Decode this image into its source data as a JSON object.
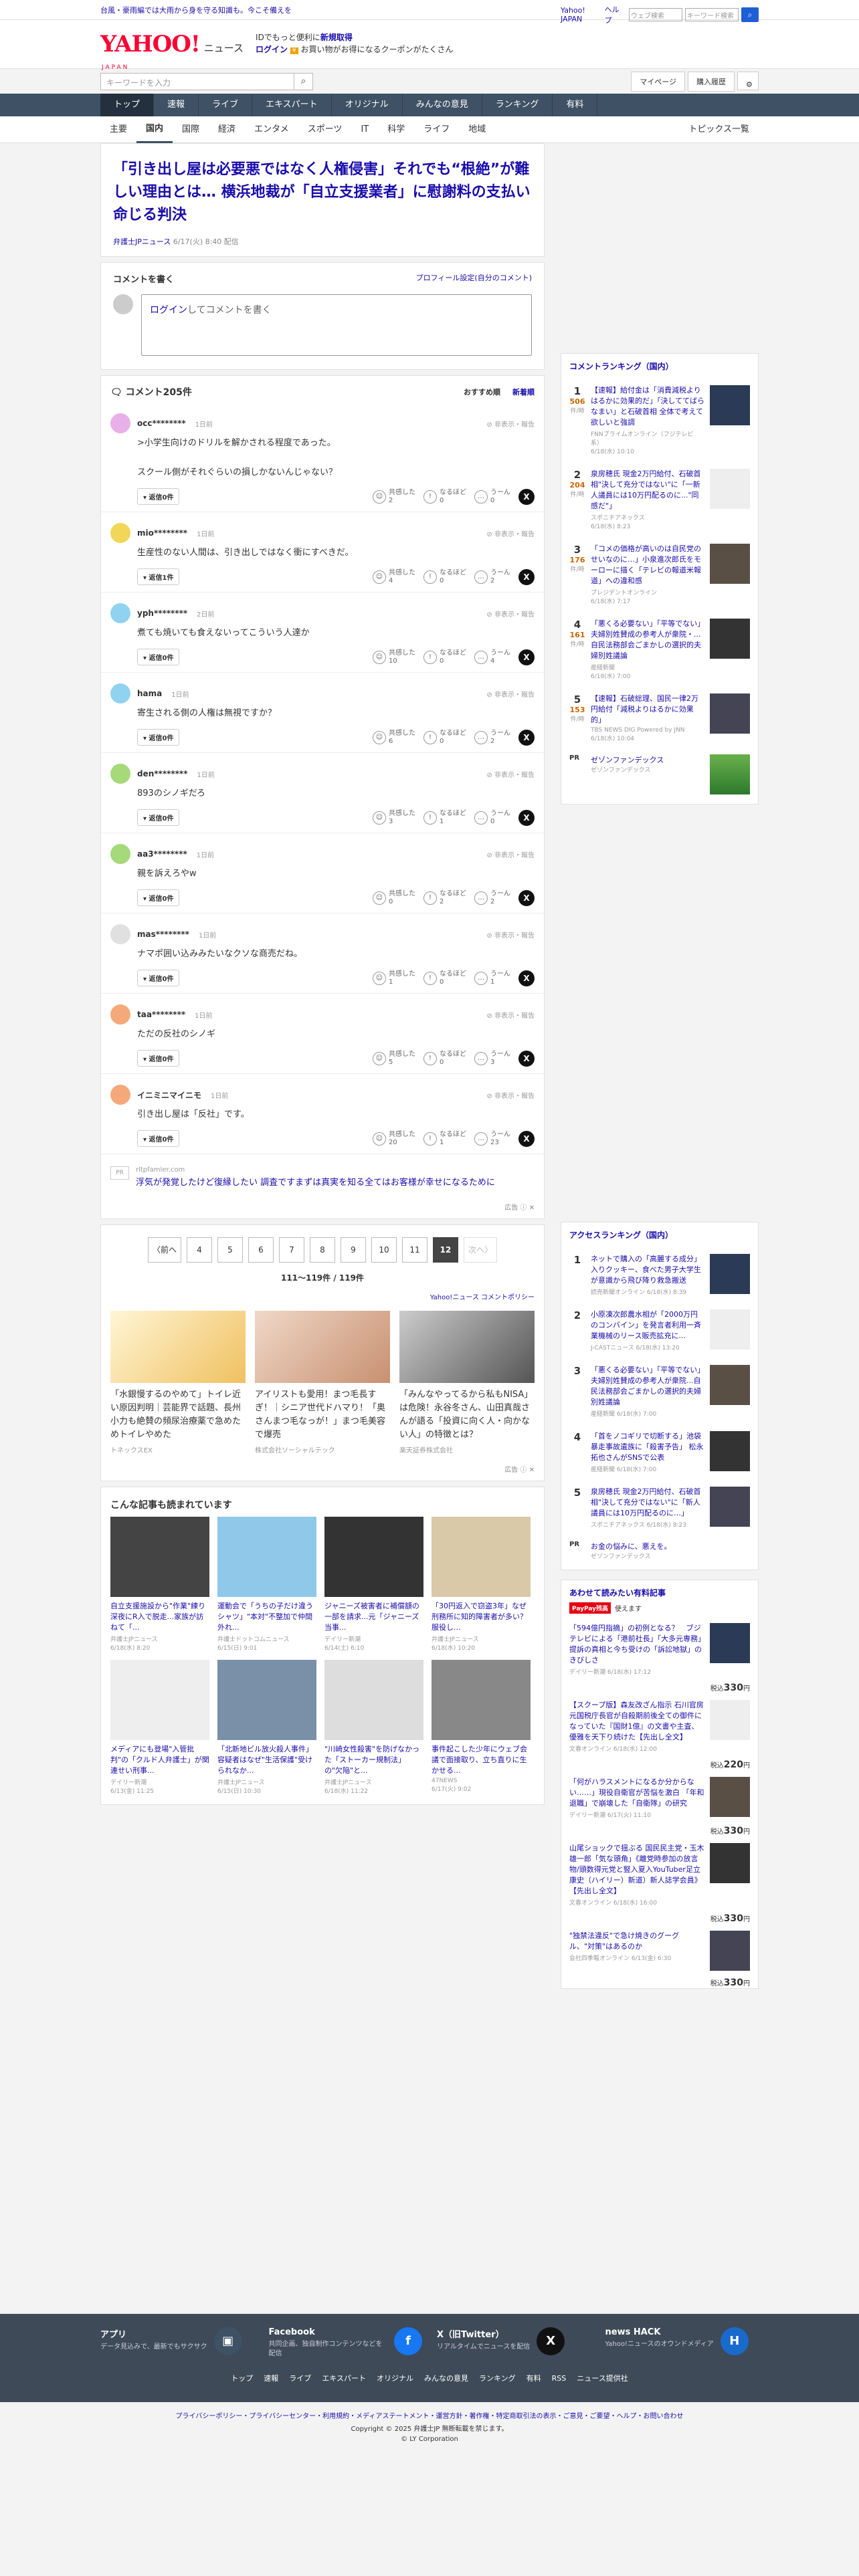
{
  "topbar": {
    "promo": "台風・豪雨編では大雨から身を守る知識も。今こそ備えを",
    "links": [
      "Yahoo! JAPAN",
      "ヘルプ"
    ],
    "web_search_placeholder": "ウェブ検索",
    "keyword_select": "キーワード検索",
    "search_btn": "検索"
  },
  "logo": {
    "main": "YAHOO!",
    "sub": "ニュース",
    "jp": "JAPAN"
  },
  "app_ad": {
    "line1": "IDでもっと便利に",
    "line1_link": "新規取得",
    "login": "ログイン",
    "line2": "お買い物がお得になるクーポンがたくさん"
  },
  "search": {
    "placeholder": "キーワードを入力",
    "mypage": "マイページ",
    "history": "購入履歴"
  },
  "nav1": [
    "トップ",
    "速報",
    "ライブ",
    "エキスパート",
    "オリジナル",
    "みんなの意見",
    "ランキング",
    "有料"
  ],
  "nav2": [
    "主要",
    "国内",
    "国際",
    "経済",
    "エンタメ",
    "スポーツ",
    "IT",
    "科学",
    "ライフ",
    "地域"
  ],
  "topics_link": "トピックス一覧",
  "article": {
    "title": "「引き出し屋は必要悪ではなく人権侵害」それでも“根絶”が難しい理由とは… 横浜地裁が「自立支援業者」に慰謝料の支払い命じる判決",
    "source": "弁護士JPニュース",
    "date": "6/17(火) 8:40 配信"
  },
  "comment_box": {
    "label": "コメントを書く",
    "profile": "プロフィール設定(自分のコメント)",
    "login": "ログイン",
    "prompt": "してコメントを書く"
  },
  "comments_header": {
    "count": "コメント205件",
    "sort_rec": "おすすめ順",
    "sort_new": "新着順"
  },
  "comment_labels": {
    "hide": "非表示・報告",
    "reply": "返信0件",
    "reply1": "返信1件",
    "agree": "共感した",
    "think": "なるほど",
    "hmm": "うーん"
  },
  "comments": [
    {
      "name": "occ********",
      "date": "1日前",
      "text": ">小学生向けのドリルを解かされる程度であった。\n\nスクール側がそれぐらいの損しかないんじゃない？",
      "reply": "返信0件",
      "agree": "2",
      "think": "0",
      "hmm": "0",
      "color": "#e8b0e8"
    },
    {
      "name": "mio********",
      "date": "1日前",
      "text": "生産性のない人間は、引き出しではなく衝にすべきだ。",
      "reply": "返信1件",
      "agree": "4",
      "think": "0",
      "hmm": "2",
      "color": "#f2d65a"
    },
    {
      "name": "yph********",
      "date": "2日前",
      "text": "煮ても焼いても食えないってこういう人達か",
      "reply": "返信0件",
      "agree": "10",
      "think": "0",
      "hmm": "4",
      "color": "#8fd3f0"
    },
    {
      "name": "hama",
      "date": "1日前",
      "text": "寄生される側の人権は無視ですか？",
      "reply": "返信0件",
      "agree": "6",
      "think": "0",
      "hmm": "2",
      "color": "#8fd3f0"
    },
    {
      "name": "den********",
      "date": "1日前",
      "text": "893のシノギだろ",
      "reply": "返信0件",
      "agree": "3",
      "think": "1",
      "hmm": "0",
      "color": "#a5d97a"
    },
    {
      "name": "aa3********",
      "date": "1日前",
      "text": "親を訴えろやw",
      "reply": "返信0件",
      "agree": "0",
      "think": "2",
      "hmm": "2",
      "color": "#a5d97a"
    },
    {
      "name": "mas********",
      "date": "1日前",
      "text": "ナマポ囲い込みみたいなクソな商売だね。",
      "reply": "返信0件",
      "agree": "1",
      "think": "0",
      "hmm": "1",
      "color": "#e0e0e0"
    },
    {
      "name": "taa********",
      "date": "1日前",
      "text": "ただの反社のシノギ",
      "reply": "返信0件",
      "agree": "5",
      "think": "0",
      "hmm": "3",
      "color": "#f5a97a"
    },
    {
      "name": "イニミニマイニモ",
      "date": "1日前",
      "text": "引き出し屋は「反社」です。",
      "reply": "返信0件",
      "agree": "20",
      "think": "1",
      "hmm": "23",
      "color": "#f5a97a"
    }
  ],
  "pr_item": {
    "tag": "PR",
    "src": "rltpfamler.com",
    "text": "浮気が発覚したけど復縁したい 調査ですまずは真実を知る全てはお客様が幸せになるために",
    "adlabel": "広告"
  },
  "pager": {
    "prev": "〈前へ",
    "pages": [
      "4",
      "5",
      "6",
      "7",
      "8",
      "9",
      "10",
      "11",
      "12"
    ],
    "current": "12",
    "next": "次へ〉",
    "count": "111〜119件 / 119件"
  },
  "policy": "Yahoo!ニュース コメントポリシー",
  "ads": [
    {
      "title": "「水銀慢するのやめて」トイレ近い原因判明｜芸能界で話題、長州小力も絶賛の頻尿治療薬で急めためトイレやめた",
      "src": "トネックスEX"
    },
    {
      "title": "アイリストも愛用！まつ毛長すぎ！｜シニア世代ドハマり！「奥さんまつ毛なっが！」まつ毛美容で爆売",
      "src": "株式会社ソーシャルテック"
    },
    {
      "title": "「みんなやってるから私もNISA」は危険！永谷冬さん、山田真哉さんが語る「投資に向く人・向かない人」の特徴とは？",
      "src": "楽天証券株式会社"
    }
  ],
  "ads_label": "広告",
  "reading_title": "こんな記事も読まれています",
  "reading": [
    {
      "title": "自立支援施設から\"作業\"練り深夜にR入で脱走...家族が訪ねて「...",
      "src": "弁護士JPニュース",
      "date": "6/18(水) 8:20"
    },
    {
      "title": "運動会で「うちの子だけ違うシャツ」\"本対\"不整加で仲間外れ...",
      "src": "弁護士ドットコムニュース",
      "date": "6/15(日) 9:01"
    },
    {
      "title": "ジャニーズ被害者に補償額の一部を請求...元「ジャニーズ当事...",
      "src": "デイリー新潮",
      "date": "6/14(土) 6:10"
    },
    {
      "title": "「30円返入で窃盗3年」なぜ刑務所に知的障害者が多い？ 服役し...",
      "src": "弁護士JPニュース",
      "date": "6/18(水) 10:20"
    },
    {
      "title": "メディアにも登場\"入管批判\"の「クルド人弁護士」が関連せい刑事...",
      "src": "デイリー新潮",
      "date": "6/13(金) 11:25"
    },
    {
      "title": "「北新地ビル放火殺人事件」容疑者はなぜ\"生活保護\"受けられなか...",
      "src": "弁護士JPニュース",
      "date": "6/15(日) 10:30"
    },
    {
      "title": "\"川崎女性殺害\"を防げなかった「ストーカー規制法」の\"欠陥\"と...",
      "src": "弁護士JPニュース",
      "date": "6/18(水) 11:22"
    },
    {
      "title": "事件起こした少年にウェブ会議で面接取り、立ち直りに生かせる...",
      "src": "47NEWS",
      "date": "6/17(火) 9:02"
    }
  ],
  "ranking": {
    "title": "コメントランキング（国内）",
    "items": [
      {
        "n": "1",
        "count": "506",
        "t": "【速報】給付金は「消費減税よりはるかに効果的だ」「決しててばらなまい」と石破首相 全体で考えて欲しいと強調",
        "s": "FNNプライムオンライン（フジテレビ系）",
        "d": "6/18(水) 10:10"
      },
      {
        "n": "2",
        "count": "204",
        "t": "泉房穂氏 現金2万円給付、石破首相\"決して充分ではない\"に「一新人議員には10万円配るのに...\"同感だ\"」",
        "s": "スポニチアネックス",
        "d": "6/18(水) 8:23"
      },
      {
        "n": "3",
        "count": "176",
        "t": "「コメの価格が高いのは自民党のせいなのに…」小泉進次郎氏をモーローに描く「テレビの報道米報道」への違和感",
        "s": "プレジデントオンライン",
        "d": "6/18(水) 7:17"
      },
      {
        "n": "4",
        "count": "161",
        "t": "「悪くる必要ない」「平等でない」夫婦別姓賛成の参考人が衆院・... 自民法務部会ごまかしの選択的夫婦別姓議論",
        "s": "産経新聞",
        "d": "6/18(水) 7:00"
      },
      {
        "n": "5",
        "count": "153",
        "t": "【速報】石破総理、国民一律2万円給付「減税よりはるかに効果的」",
        "s": "TBS NEWS DIG Powered by JNN",
        "d": "6/18(水) 10:04"
      }
    ],
    "count_label": "件/時"
  },
  "pr_side": {
    "tag": "PR",
    "t": "ゼゾンファンデックス",
    "s": "ゼゾンファンデックス"
  },
  "access": {
    "title": "アクセスランキング（国内）",
    "items": [
      {
        "n": "1",
        "t": "ネットで購入の「高麗する成分」入りクッキー、食べた男子大学生が意識から飛び降り救急搬送",
        "s": "読売新聞オンライン",
        "d": "6/18(水) 8:39"
      },
      {
        "n": "2",
        "t": "小原凍次郎農水相が「2000万円のコンバイン」を発言者利用一斉業機械のリース販売拡充に...",
        "s": "J-CASTニュース",
        "d": "6/18(水) 13:20"
      },
      {
        "n": "3",
        "t": "「悪くる必要ない」「平等でない」夫婦別姓賛成の参考人が衆院...自民法務部会ごまかしの選択的夫婦別姓議論",
        "s": "産経新聞",
        "d": "6/18(水) 7:00"
      },
      {
        "n": "4",
        "t": "「首をノコギリで切断する」池袋暴走事故遺族に「殺害予告」 松永拓也さんがSNSで公表",
        "s": "産経新聞",
        "d": "6/18(水) 7:00"
      },
      {
        "n": "5",
        "t": "泉房穂氏 現金2万円給付、石破首相\"決して充分ではない\"に「新人議員には10万円配るのに…」",
        "s": "スポニチアネックス",
        "d": "6/18(水) 8:23"
      }
    ]
  },
  "pr_side2": {
    "tag": "PR",
    "t": "お金の悩みに、悪えを。",
    "s": "ゼゾンファンデックス"
  },
  "shop": {
    "title": "あわせて読みたい有料記事",
    "paypay": "PayPay残高",
    "paypay_text": "使えます",
    "items": [
      {
        "t": "「594億円指摘」の初例となる？　ブジテレビによる「港前社長」「大多元専務」提訴の真相と今ち受けの「訴訟地獄」のきびしさ",
        "s": "デイリー新潮",
        "d": "6/18(水) 17:12",
        "price": "330"
      },
      {
        "t": "【スクープ版】森友改ざん指示 石川官房元国税庁長官が自殺期前後全ての御件になっていた『国財1億』の文書や主査、優雅を天下り続けた【先出し全文】",
        "s": "文春オンライン",
        "d": "6/18(水) 12:00",
        "price": "220"
      },
      {
        "t": "「何がハラスメントになるか分からない……」現役自衛官が苦悩を激白 「年和退職」で崩壊した「自衛隊」の研究",
        "s": "デイリー新潮",
        "d": "6/17(火) 11:10",
        "price": "330"
      },
      {
        "t": "山尾ショックで揺ぶる 国民民主党・玉木雄一郎「気な頭角」《離党時参加の放言物/頭数得元党と竪入夏入YouTuber足立康史（ハイリー）新道）新人誌学会員》【先出し全文】",
        "s": "文春オンライン",
        "d": "6/18(水) 16:00",
        "price": "330"
      },
      {
        "t": "\"独禁法違反\"で急け焼きのグーグル、\"対策\"はあるのか",
        "s": "会社四季報オンライン",
        "d": "6/13(金) 6:30",
        "price": "330"
      }
    ],
    "tax": "税込",
    "yen": "円"
  },
  "footer": {
    "apps": [
      {
        "title": "アプリ",
        "desc": "データ見込みで、最新でもサクサク"
      },
      {
        "title": "Facebook",
        "desc": "共同企画、独自制作コンテンツなどを配信"
      },
      {
        "title": "X（旧Twitter）",
        "desc": "リアルタイムでニュースを配信"
      },
      {
        "title": "news HACK",
        "desc": "Yahoo!ニュースのオウンドメディア"
      }
    ],
    "links": [
      "トップ",
      "速報",
      "ライブ",
      "エキスパート",
      "オリジナル",
      "みんなの意見",
      "ランキング",
      "有料",
      "RSS",
      "ニュース提供社"
    ],
    "legal": "プライバシーポリシー・プライバシーセンター・利用規約・メディアステートメント・運営方針・著作権・特定商取引法の表示・ご意見・ご要望・ヘルプ・お問い合わせ",
    "copyright": "Copyright © 2025 弁護士JP 無断転載を禁じます。",
    "corp": "© LY Corporation"
  },
  "colors": {
    "accent": "#1a0dab",
    "brand": "#ff0033",
    "nav": "#3e5165"
  }
}
